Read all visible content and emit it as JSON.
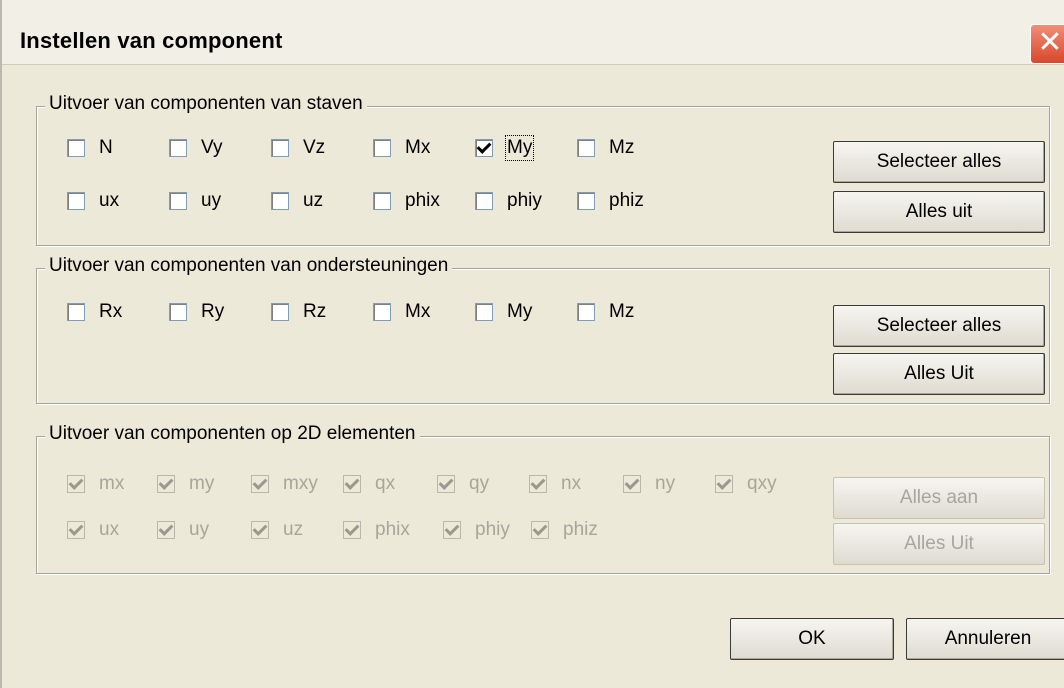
{
  "window": {
    "title": "Instellen van component",
    "close_symbol": "✕"
  },
  "staven": {
    "title": "Uitvoer van componenten van staven",
    "row1": [
      {
        "label": "N",
        "checked": false
      },
      {
        "label": "Vy",
        "checked": false
      },
      {
        "label": "Vz",
        "checked": false
      },
      {
        "label": "Mx",
        "checked": false
      },
      {
        "label": "My",
        "checked": true
      },
      {
        "label": "Mz",
        "checked": false
      }
    ],
    "row2": [
      {
        "label": "ux",
        "checked": false
      },
      {
        "label": "uy",
        "checked": false
      },
      {
        "label": "uz",
        "checked": false
      },
      {
        "label": "phix",
        "checked": false
      },
      {
        "label": "phiy",
        "checked": false
      },
      {
        "label": "phiz",
        "checked": false
      }
    ],
    "select_all": "Selecteer alles",
    "all_off": "Alles uit"
  },
  "ondersteuningen": {
    "title": "Uitvoer van componenten van ondersteuningen",
    "row1": [
      {
        "label": "Rx",
        "checked": false
      },
      {
        "label": "Ry",
        "checked": false
      },
      {
        "label": "Rz",
        "checked": false
      },
      {
        "label": "Mx",
        "checked": false
      },
      {
        "label": "My",
        "checked": false
      },
      {
        "label": "Mz",
        "checked": false
      }
    ],
    "select_all": "Selecteer alles",
    "all_off": "Alles Uit"
  },
  "elementen2d": {
    "title": "Uitvoer van componenten op 2D elementen",
    "row1": [
      {
        "label": "mx",
        "checked": true
      },
      {
        "label": "my",
        "checked": true
      },
      {
        "label": "mxy",
        "checked": true
      },
      {
        "label": "qx",
        "checked": true
      },
      {
        "label": "qy",
        "checked": true
      },
      {
        "label": "nx",
        "checked": true
      },
      {
        "label": "ny",
        "checked": true
      },
      {
        "label": "qxy",
        "checked": true
      }
    ],
    "row2": [
      {
        "label": "ux",
        "checked": true
      },
      {
        "label": "uy",
        "checked": true
      },
      {
        "label": "uz",
        "checked": true
      },
      {
        "label": "phix",
        "checked": true
      },
      {
        "label": "phiy",
        "checked": true
      },
      {
        "label": "phiz",
        "checked": true
      }
    ],
    "all_on": "Alles aan",
    "all_off": "Alles Uit"
  },
  "footer": {
    "ok": "OK",
    "cancel": "Annuleren"
  }
}
